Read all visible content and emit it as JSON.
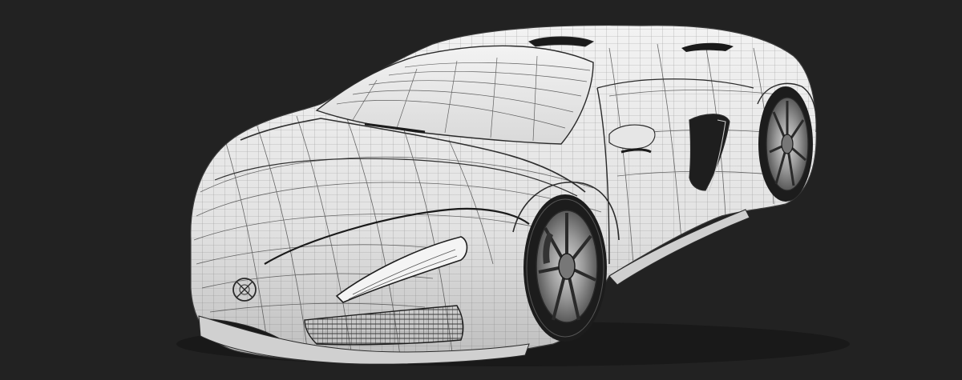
{
  "scene": {
    "subject": "car-wireframe-render",
    "colors": {
      "background": "#222222",
      "body": "#e9e9e9",
      "wire": "#4a4a4a",
      "shadow": "#8d8d8d",
      "dark": "#141414",
      "tire": "#1c1c1c",
      "rim": "#b5b5b5"
    }
  }
}
